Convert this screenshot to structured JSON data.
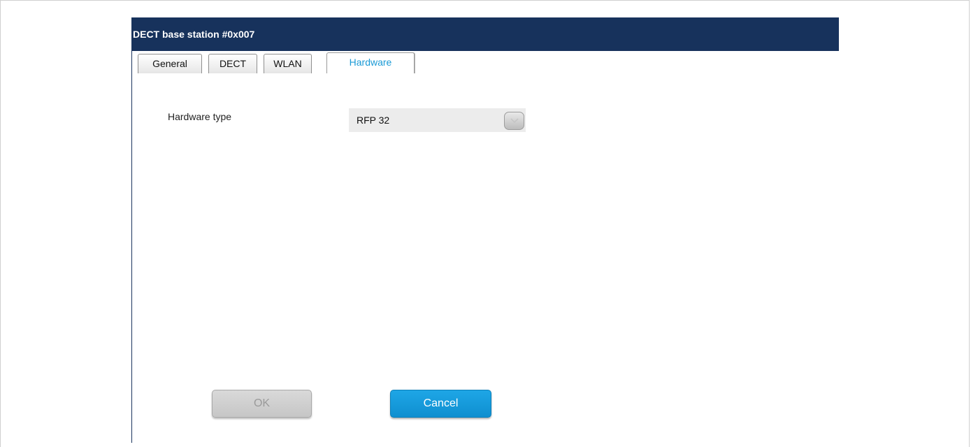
{
  "dialog": {
    "title": "DECT base station #0x007"
  },
  "tabs": [
    {
      "label": "General",
      "active": false
    },
    {
      "label": "DECT",
      "active": false
    },
    {
      "label": "WLAN",
      "active": false
    },
    {
      "label": "Hardware",
      "active": true
    }
  ],
  "hardware": {
    "type_label": "Hardware type",
    "type_value": "RFP 32",
    "dropdown_icon": "chevron-down-icon"
  },
  "buttons": {
    "ok_label": "OK",
    "cancel_label": "Cancel"
  },
  "colors": {
    "titlebar": "#17325c",
    "active_tab_text": "#1a9ad6",
    "cancel_button": "#1296d8",
    "ok_button_disabled": "#cfcfcf"
  }
}
